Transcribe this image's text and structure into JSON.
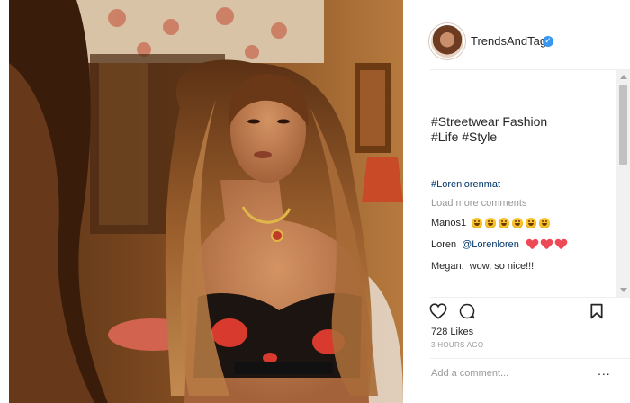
{
  "post": {
    "username": "TrendsAndTags",
    "verified_icon": "verified-badge-icon",
    "caption": "#Streetwear Fashion\n#Life #Style",
    "hashtag_line": "#Lorenlorenmat",
    "load_more": "Load more comments",
    "comments": [
      {
        "user": "Manos1",
        "emoji": [
          "grinning-face",
          "grinning-face",
          "grinning-face",
          "grinning-face",
          "grinning-face",
          "grinning-face"
        ]
      },
      {
        "user": "Loren",
        "mention": "@Lorenloren",
        "emoji": [
          "red-heart",
          "red-heart",
          "red-heart"
        ]
      },
      {
        "user": "Megan:",
        "text": "wow, so nice!!!"
      }
    ],
    "likes_count": "728",
    "likes_label": "Likes",
    "timestamp": "3 HOURS AGO",
    "comment_placeholder": "Add a comment...",
    "more_label": "..."
  },
  "colors": {
    "link": "#003569",
    "muted": "#999999",
    "text": "#262626",
    "verified": "#3897f0",
    "heart": "#ed4956"
  }
}
